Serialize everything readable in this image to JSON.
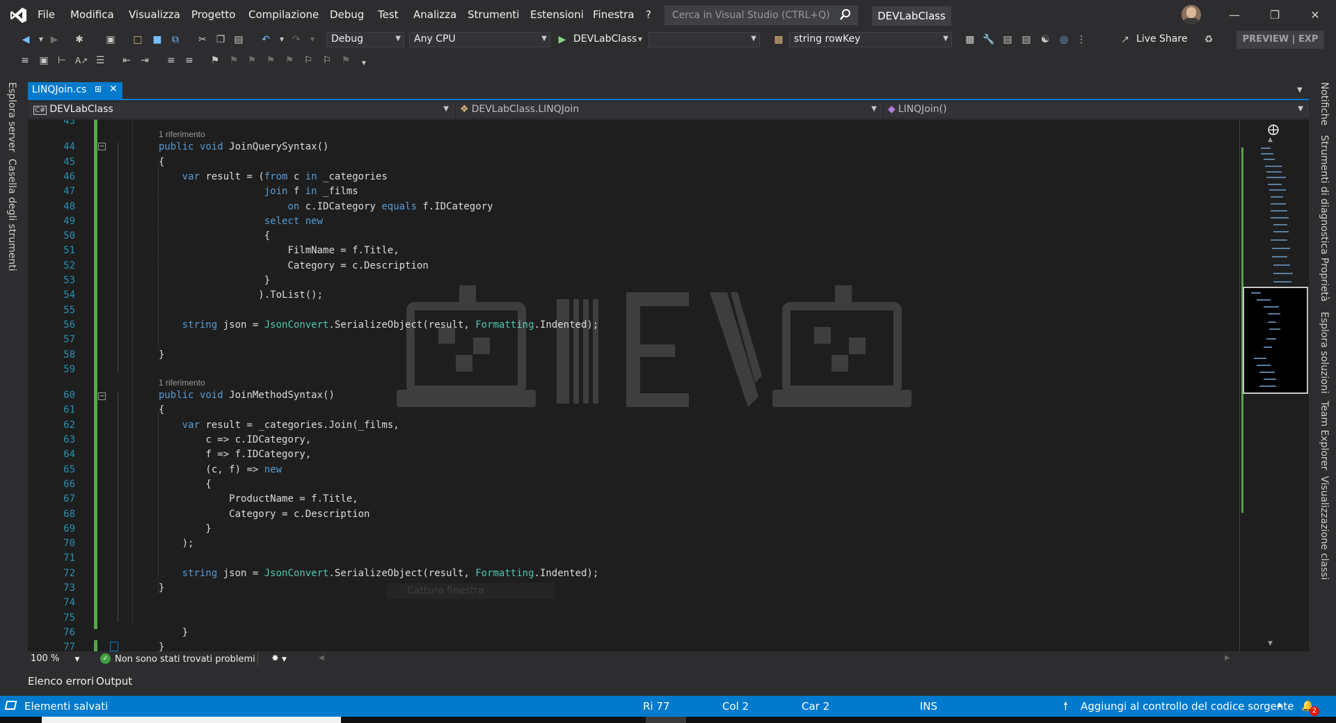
{
  "menu": {
    "items": [
      "File",
      "Modifica",
      "Visualizza",
      "Progetto",
      "Compilazione",
      "Debug",
      "Test",
      "Analizza",
      "Strumenti",
      "Estensioni",
      "Finestra",
      "?"
    ],
    "search_placeholder": "Cerca in Visual Studio (CTRL+Q)",
    "solution_name": "DEVLabClass"
  },
  "toolbar": {
    "config": "Debug",
    "platform": "Any CPU",
    "start_label": "DEVLabClass",
    "find_value": "string rowKey",
    "live_share": "Live Share",
    "preview": "PREVIEW | EXP"
  },
  "left_tabs": [
    "Esplora server",
    "Casella degli strumenti"
  ],
  "right_tabs": [
    "Notifiche",
    "Strumenti di diagnostica",
    "Proprietà",
    "Esplora soluzioni",
    "Team Explorer",
    "Visualizzazione classi"
  ],
  "document": {
    "tab_name": "LINQJoin.cs",
    "nav_project": "DEVLabClass",
    "nav_class": "DEVLabClass.LINQJoin",
    "nav_member": "LINQJoin()"
  },
  "code": {
    "codelens_text": "1 riferimento",
    "lines": [
      {
        "n": "43",
        "t": ""
      },
      {
        "n": "44",
        "t": "public void JoinQuerySyntax()"
      },
      {
        "n": "45",
        "t": "{"
      },
      {
        "n": "46",
        "t": "    var result = (from c in _categories"
      },
      {
        "n": "47",
        "t": "                  join f in _films"
      },
      {
        "n": "48",
        "t": "                      on c.IDCategory equals f.IDCategory"
      },
      {
        "n": "49",
        "t": "                  select new"
      },
      {
        "n": "50",
        "t": "                  {"
      },
      {
        "n": "51",
        "t": "                      FilmName = f.Title,"
      },
      {
        "n": "52",
        "t": "                      Category = c.Description"
      },
      {
        "n": "53",
        "t": "                  }"
      },
      {
        "n": "54",
        "t": "                 ).ToList();"
      },
      {
        "n": "55",
        "t": ""
      },
      {
        "n": "56",
        "t": "    string json = JsonConvert.SerializeObject(result, Formatting.Indented);"
      },
      {
        "n": "57",
        "t": ""
      },
      {
        "n": "58",
        "t": "}"
      },
      {
        "n": "59",
        "t": ""
      },
      {
        "n": "60",
        "t": "public void JoinMethodSyntax()"
      },
      {
        "n": "61",
        "t": "{"
      },
      {
        "n": "62",
        "t": "    var result = _categories.Join(_films,"
      },
      {
        "n": "63",
        "t": "        c => c.IDCategory,"
      },
      {
        "n": "64",
        "t": "        f => f.IDCategory,"
      },
      {
        "n": "65",
        "t": "        (c, f) => new"
      },
      {
        "n": "66",
        "t": "        {"
      },
      {
        "n": "67",
        "t": "            ProductName = f.Title,"
      },
      {
        "n": "68",
        "t": "            Category = c.Description"
      },
      {
        "n": "69",
        "t": "        }"
      },
      {
        "n": "70",
        "t": "    );"
      },
      {
        "n": "71",
        "t": ""
      },
      {
        "n": "72",
        "t": "    string json = JsonConvert.SerializeObject(result, Formatting.Indented);"
      },
      {
        "n": "73",
        "t": "}"
      },
      {
        "n": "74",
        "t": ""
      },
      {
        "n": "75",
        "t": ""
      },
      {
        "n": "76",
        "t": "    }"
      },
      {
        "n": "77",
        "t": "}"
      }
    ]
  },
  "ghost_tooltip": "Cattura finestra",
  "editor_status": {
    "zoom": "100 %",
    "issues": "Non sono stati trovati problemi"
  },
  "bottom_tabs": [
    "Elenco errori",
    "Output"
  ],
  "status": {
    "message": "Elementi salvati",
    "row": "Ri 77",
    "col": "Col 2",
    "char": "Car 2",
    "mode": "INS",
    "source_control": "Aggiungi al controllo del codice sorgente",
    "notifications": "2"
  },
  "colors": {
    "accent": "#007acc",
    "editor_bg": "#1e1e1e",
    "chrome_bg": "#2d2d30",
    "keyword": "#569cd6",
    "type": "#4ec9b0",
    "line_number": "#2b91af",
    "change_bar": "#57a64a"
  }
}
